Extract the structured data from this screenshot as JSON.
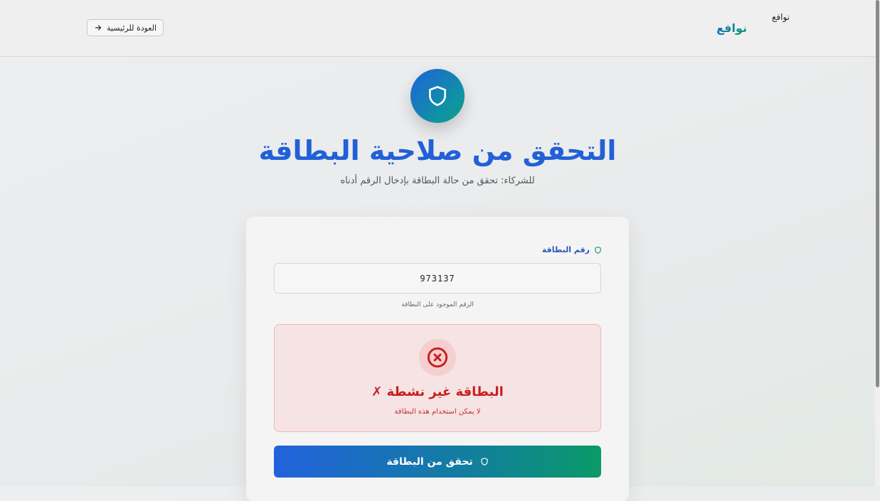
{
  "header": {
    "back_label": "العودة للرئيسية",
    "logo_img_alt": "نوافع",
    "logo_text": "نوافع"
  },
  "hero": {
    "title": "التحقق من صلاحية البطاقة",
    "subtitle": "للشركاء: تحقق من حالة البطاقة بإدخال الرقم أدناه"
  },
  "form": {
    "card_number_label": "رقم البطاقة",
    "card_number_value": "973137",
    "card_number_hint": "الرقم الموجود على البطاقة",
    "submit_label": "تحقق من البطاقة"
  },
  "result": {
    "status": "inactive",
    "title": "البطاقة غير نشطة ✗",
    "message": "لا يمكن استخدام هذه البطاقة"
  },
  "colors": {
    "brand_blue": "#2260d8",
    "brand_green": "#0a9a68",
    "error_red": "#c81e1e"
  }
}
